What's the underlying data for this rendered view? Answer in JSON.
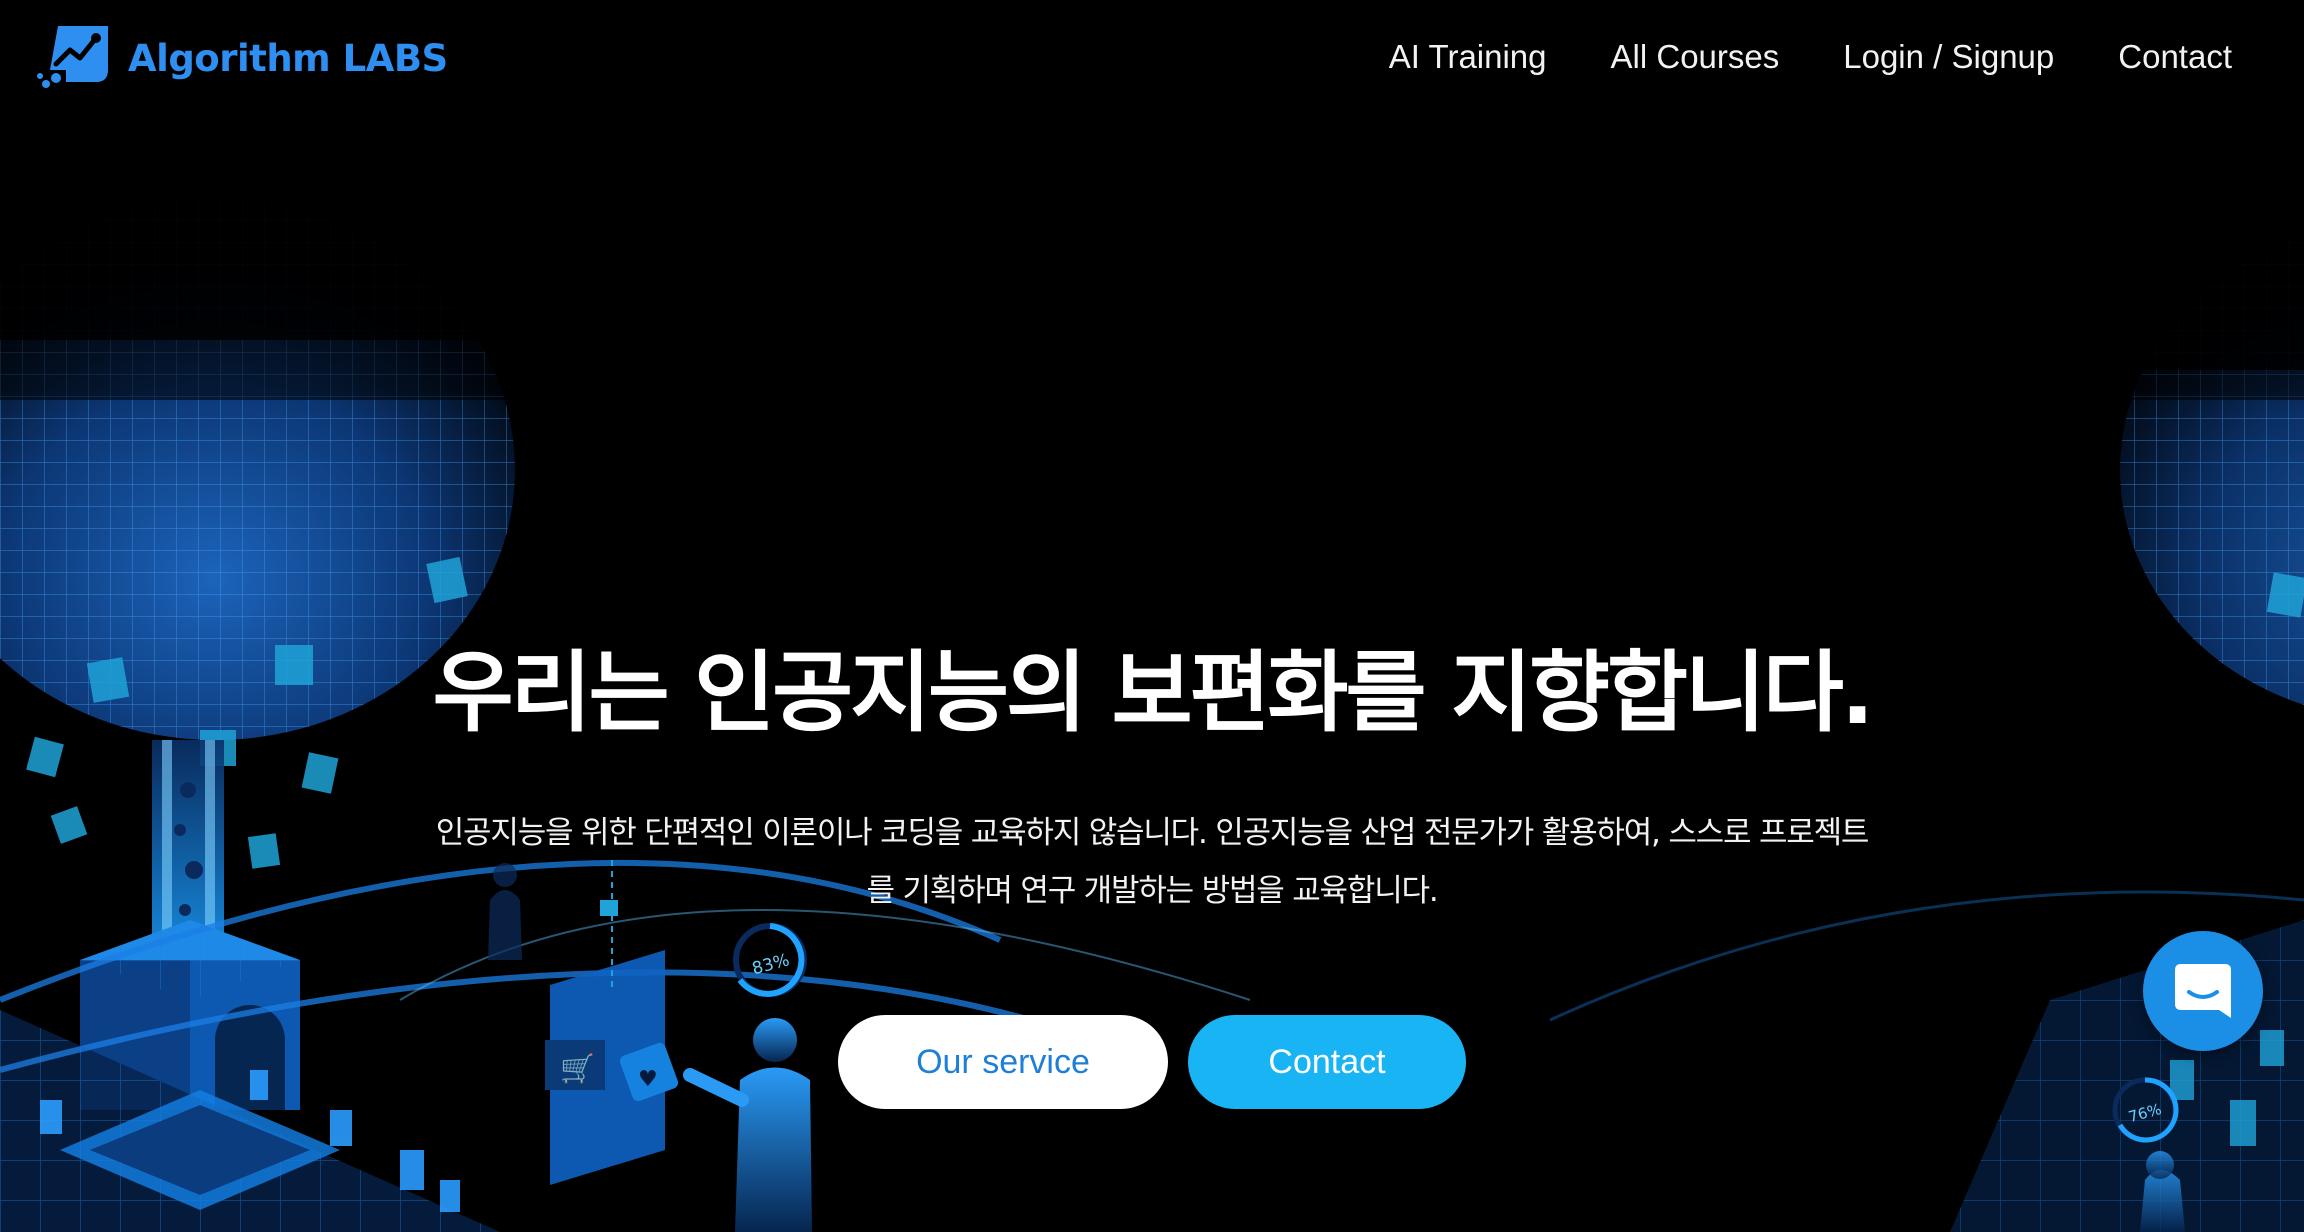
{
  "brand": {
    "name": "Algorithm LABS",
    "accent": "#2e8ff0"
  },
  "nav": {
    "links": [
      "AI Training",
      "All Courses",
      "Login / Signup",
      "Contact"
    ]
  },
  "hero": {
    "title": "우리는 인공지능의 보편화를 지향합니다.",
    "description_lines": [
      "인공지능을 위한 단편적인 이론이나 코딩을 교육하지 않습니다. 인공지능을 산업 전문가가 활용하여, 스스로 프로젝트",
      "를 기획하며 연구 개발하는 방법을 교육합니다."
    ],
    "buttons": {
      "primary": "Our service",
      "secondary": "Contact"
    }
  },
  "illustration": {
    "left_gauge": "83%",
    "right_gauge": "76%"
  },
  "chat": {
    "icon": "chat-bubble-icon"
  },
  "colors": {
    "background": "#000000",
    "service_button_bg": "#ffffff",
    "service_button_text": "#1f7fd6",
    "contact_button_bg": "#19b4f3",
    "chat_launcher": "#1b8fe6"
  }
}
